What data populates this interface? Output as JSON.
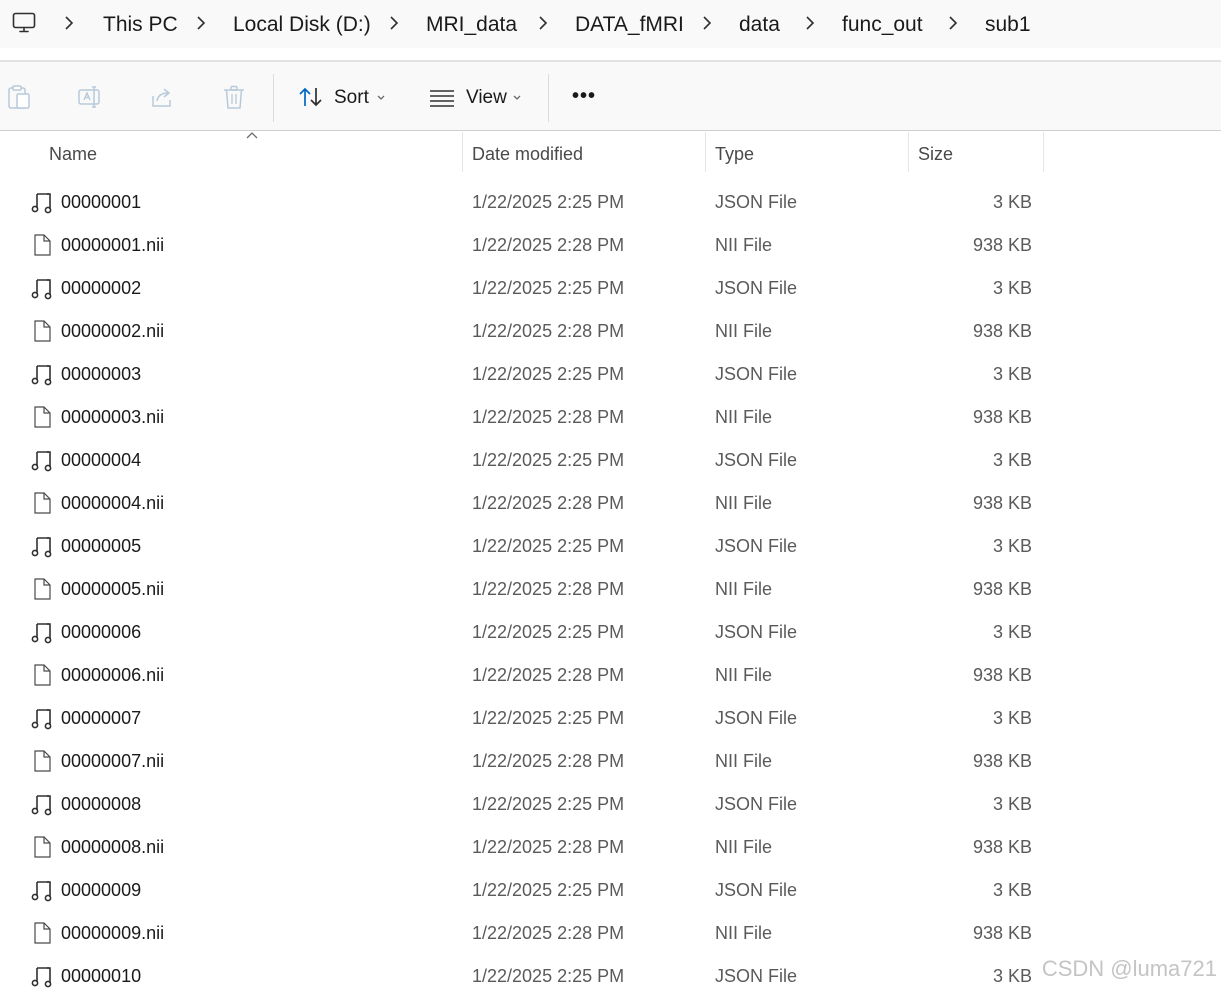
{
  "breadcrumb": {
    "items": [
      "This PC",
      "Local Disk (D:)",
      "MRI_data",
      "DATA_fMRI",
      "data",
      "func_out",
      "sub1"
    ]
  },
  "toolbar": {
    "sort_label": "Sort",
    "view_label": "View",
    "more_label": "•••"
  },
  "columns": {
    "name": "Name",
    "date": "Date modified",
    "type": "Type",
    "size": "Size"
  },
  "files": [
    {
      "name": "00000001",
      "date": "1/22/2025 2:25 PM",
      "type": "JSON File",
      "size": "3 KB",
      "icon": "json-file-icon"
    },
    {
      "name": "00000001.nii",
      "date": "1/22/2025 2:28 PM",
      "type": "NII File",
      "size": "938 KB",
      "icon": "blank-file-icon"
    },
    {
      "name": "00000002",
      "date": "1/22/2025 2:25 PM",
      "type": "JSON File",
      "size": "3 KB",
      "icon": "json-file-icon"
    },
    {
      "name": "00000002.nii",
      "date": "1/22/2025 2:28 PM",
      "type": "NII File",
      "size": "938 KB",
      "icon": "blank-file-icon"
    },
    {
      "name": "00000003",
      "date": "1/22/2025 2:25 PM",
      "type": "JSON File",
      "size": "3 KB",
      "icon": "json-file-icon"
    },
    {
      "name": "00000003.nii",
      "date": "1/22/2025 2:28 PM",
      "type": "NII File",
      "size": "938 KB",
      "icon": "blank-file-icon"
    },
    {
      "name": "00000004",
      "date": "1/22/2025 2:25 PM",
      "type": "JSON File",
      "size": "3 KB",
      "icon": "json-file-icon"
    },
    {
      "name": "00000004.nii",
      "date": "1/22/2025 2:28 PM",
      "type": "NII File",
      "size": "938 KB",
      "icon": "blank-file-icon"
    },
    {
      "name": "00000005",
      "date": "1/22/2025 2:25 PM",
      "type": "JSON File",
      "size": "3 KB",
      "icon": "json-file-icon"
    },
    {
      "name": "00000005.nii",
      "date": "1/22/2025 2:28 PM",
      "type": "NII File",
      "size": "938 KB",
      "icon": "blank-file-icon"
    },
    {
      "name": "00000006",
      "date": "1/22/2025 2:25 PM",
      "type": "JSON File",
      "size": "3 KB",
      "icon": "json-file-icon"
    },
    {
      "name": "00000006.nii",
      "date": "1/22/2025 2:28 PM",
      "type": "NII File",
      "size": "938 KB",
      "icon": "blank-file-icon"
    },
    {
      "name": "00000007",
      "date": "1/22/2025 2:25 PM",
      "type": "JSON File",
      "size": "3 KB",
      "icon": "json-file-icon"
    },
    {
      "name": "00000007.nii",
      "date": "1/22/2025 2:28 PM",
      "type": "NII File",
      "size": "938 KB",
      "icon": "blank-file-icon"
    },
    {
      "name": "00000008",
      "date": "1/22/2025 2:25 PM",
      "type": "JSON File",
      "size": "3 KB",
      "icon": "json-file-icon"
    },
    {
      "name": "00000008.nii",
      "date": "1/22/2025 2:28 PM",
      "type": "NII File",
      "size": "938 KB",
      "icon": "blank-file-icon"
    },
    {
      "name": "00000009",
      "date": "1/22/2025 2:25 PM",
      "type": "JSON File",
      "size": "3 KB",
      "icon": "json-file-icon"
    },
    {
      "name": "00000009.nii",
      "date": "1/22/2025 2:28 PM",
      "type": "NII File",
      "size": "938 KB",
      "icon": "blank-file-icon"
    },
    {
      "name": "00000010",
      "date": "1/22/2025 2:25 PM",
      "type": "JSON File",
      "size": "3 KB",
      "icon": "json-file-icon"
    }
  ],
  "watermark": "CSDN @luma721",
  "colors": {
    "accent": "#0067c0",
    "header_bg": "#f9f9f9",
    "secondary_text": "#5a5a5a"
  }
}
